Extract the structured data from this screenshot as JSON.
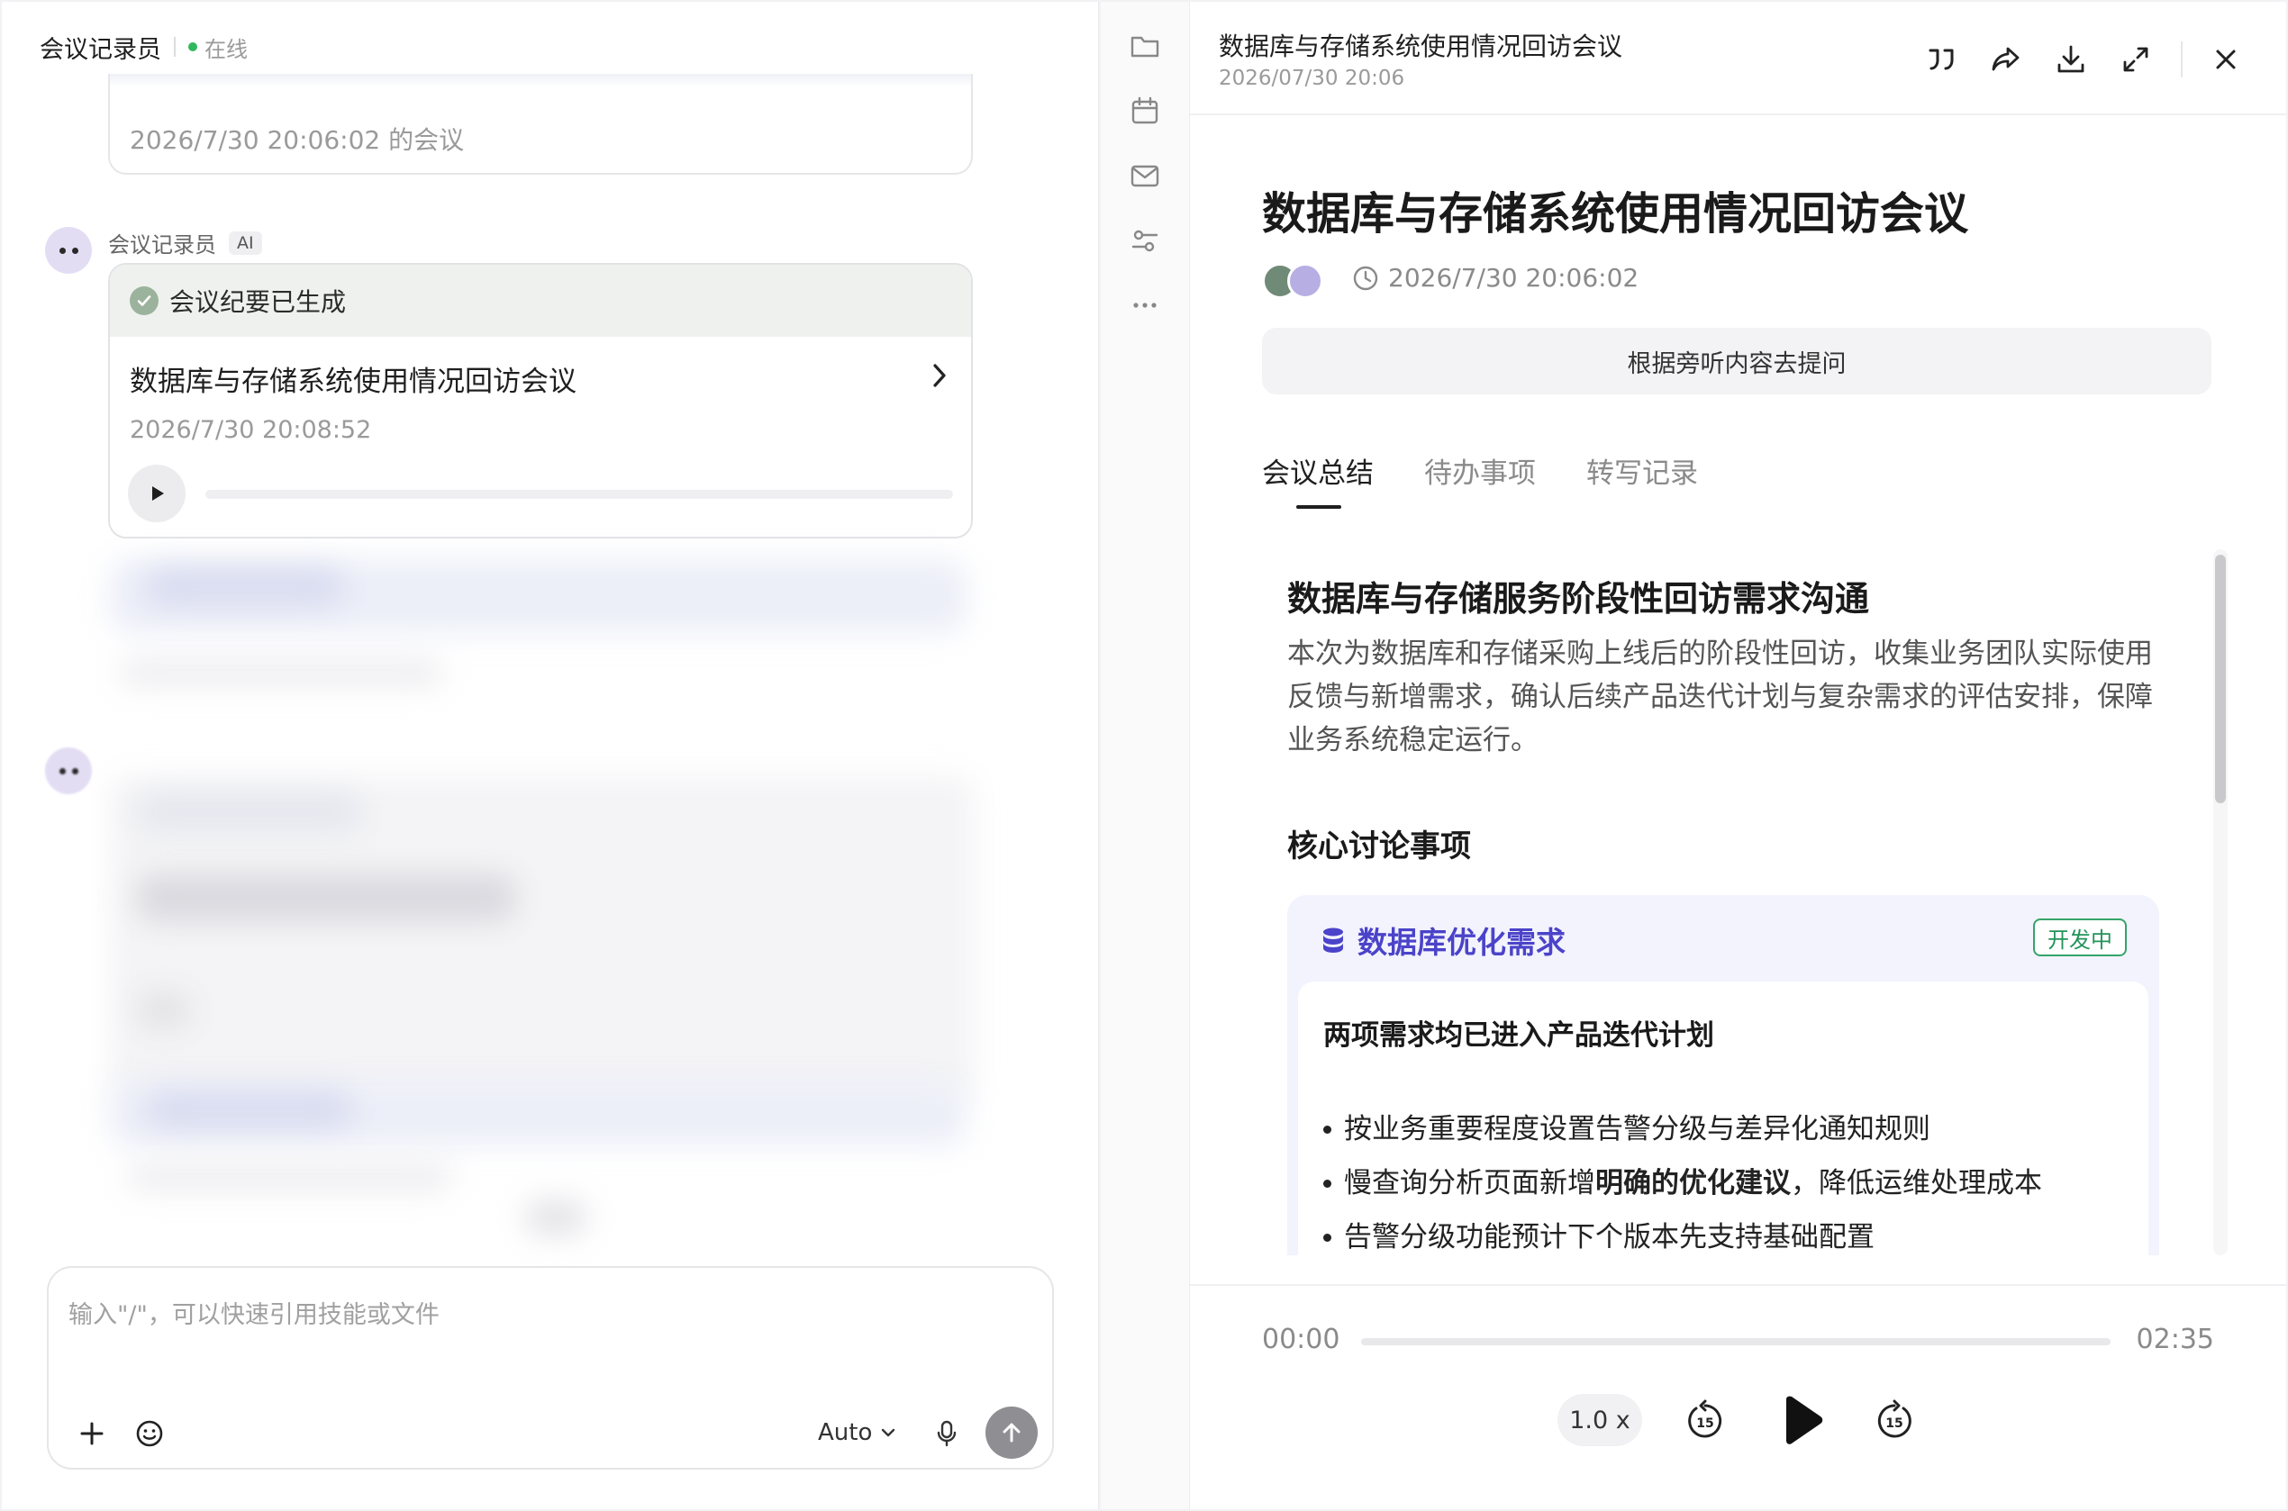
{
  "left": {
    "agent_name": "会议记录员",
    "status": "在线",
    "prev_message": "2026/7/30 20:06:02 的会议",
    "sender_name": "会议记录员",
    "ai_badge": "AI",
    "card": {
      "header": "会议纪要已生成",
      "title": "数据库与存储系统使用情况回访会议",
      "time": "2026/7/30 20:08:52"
    },
    "composer": {
      "placeholder": "输入\"/\"，可以快速引用技能或文件",
      "model": "Auto"
    }
  },
  "rail": {
    "icons": [
      "folder-icon",
      "calendar-icon",
      "mail-icon",
      "settings-sliders-icon",
      "more-icon"
    ]
  },
  "right": {
    "header_title": "数据库与存储系统使用情况回访会议",
    "header_date": "2026/07/30 20:06",
    "doc_title": "数据库与存储系统使用情况回访会议",
    "doc_time": "2026/7/30 20:06:02",
    "ask_button": "根据旁听内容去提问",
    "tabs": [
      "会议总结",
      "待办事项",
      "转写记录"
    ],
    "summary": {
      "heading": "数据库与存储服务阶段性回访需求沟通",
      "paragraph": "本次为数据库和存储采购上线后的阶段性回访，收集业务团队实际使用反馈与新增需求，确认后续产品迭代计划与复杂需求的评估安排，保障业务系统稳定运行。",
      "section": "核心讨论事项",
      "topic": {
        "title": "数据库优化需求",
        "status": "开发中",
        "body_title": "两项需求均已进入产品迭代计划",
        "bullet_1": "按业务重要程度设置告警分级与差异化通知规则",
        "bullet_2_pre": "慢查询分析页面新增",
        "bullet_2_bold": "明确的优化建议",
        "bullet_2_post": "，降低运维处理成本",
        "bullet_3": "告警分级功能预计下个版本先支持基础配置"
      }
    },
    "player": {
      "current": "00:00",
      "duration": "02:35",
      "speed": "1.0 x",
      "progress": 0
    }
  },
  "colors": {
    "accent_purple": "#4b43c9",
    "status_green": "#23935a",
    "online_green": "#2fb85b"
  }
}
